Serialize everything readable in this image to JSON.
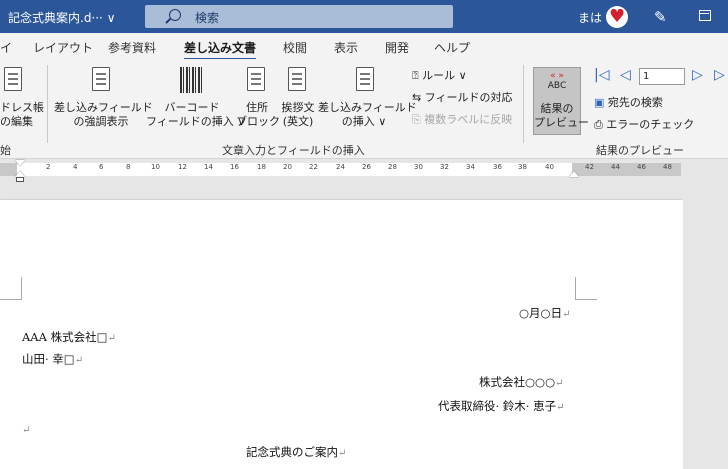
{
  "titlebar": {
    "document_name": "記念式典案内.d··· ∨",
    "search_placeholder": "検索",
    "user_name": "まは"
  },
  "tabs": [
    "イ",
    "レイアウト",
    "参考資料",
    "差し込み文書",
    "校閲",
    "表示",
    "開発",
    "ヘルプ"
  ],
  "active_tab": "差し込み文書",
  "ribbon": {
    "address_book": [
      "ドレス帳",
      "の編集"
    ],
    "highlight_fields": [
      "差し込みフィールド",
      "の強調表示"
    ],
    "barcode": [
      "バーコード",
      "フィールドの挿入 ∨"
    ],
    "address_block": [
      "住所",
      "ブロック"
    ],
    "greeting_line": [
      "挨拶文",
      "(英文)"
    ],
    "insert_field": [
      "差し込みフィールド",
      "の挿入 ∨"
    ],
    "rules": "ルール ∨",
    "match_fields": "フィールドの対応",
    "update_labels": "複数ラベルに反映",
    "group_write_insert": "文章入力とフィールドの挿入",
    "group_start_fragment": "始",
    "preview_results": [
      "結果の",
      "プレビュー"
    ],
    "preview_abc": "ABC",
    "preview_arrows": "«  »",
    "record_number": "1",
    "find_recipient": "宛先の検索",
    "check_errors": "エラーのチェック",
    "group_preview": "結果のプレビュー"
  },
  "ruler": {
    "ticks": [
      "2",
      "4",
      "6",
      "8",
      "10",
      "12",
      "14",
      "16",
      "18",
      "20",
      "22",
      "24",
      "26",
      "28",
      "30",
      "32",
      "34",
      "36",
      "38",
      "40",
      "42",
      "44",
      "46",
      "48"
    ]
  },
  "document": {
    "date": "○月○日",
    "recipient_company": "AAA 株式会社□",
    "recipient_name": "山田· 幸□",
    "sender_company": "株式会社○○○",
    "sender_name": "代表取締役· 鈴木· 恵子",
    "empty_para": "",
    "title": "記念式典のご案内",
    "para_mark": "↵"
  },
  "colors": {
    "titlebar": "#2b579a",
    "accent": "#2b579a",
    "ribbon": "#f3f3f3",
    "canvas": "#e6e6e6"
  }
}
